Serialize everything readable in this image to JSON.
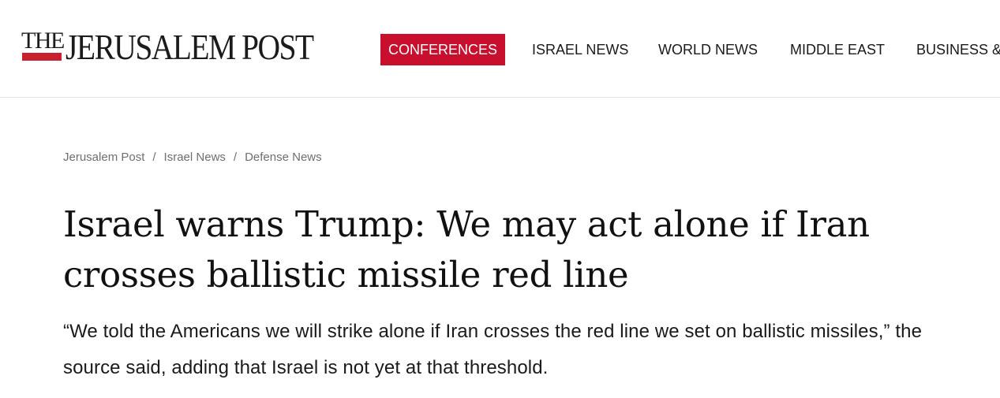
{
  "site": {
    "logo_small": "THE",
    "logo_main": "JERUSALEM POST",
    "brand_color": "#c8102e"
  },
  "nav": {
    "items": [
      {
        "label": "CONFERENCES",
        "active": true
      },
      {
        "label": "ISRAEL NEWS",
        "active": false
      },
      {
        "label": "WORLD NEWS",
        "active": false
      },
      {
        "label": "MIDDLE EAST",
        "active": false
      },
      {
        "label": "BUSINESS & I",
        "active": false
      }
    ]
  },
  "breadcrumb": {
    "items": [
      "Jerusalem Post",
      "Israel News",
      "Defense News"
    ],
    "separator": "/"
  },
  "article": {
    "headline": "Israel warns Trump: We may act alone if Iran crosses ballistic missile red line",
    "subheadline": "“We told the Americans we will strike alone if Iran crosses the red line we set on ballistic missiles,” the source said, adding that Israel is not yet at that threshold."
  }
}
